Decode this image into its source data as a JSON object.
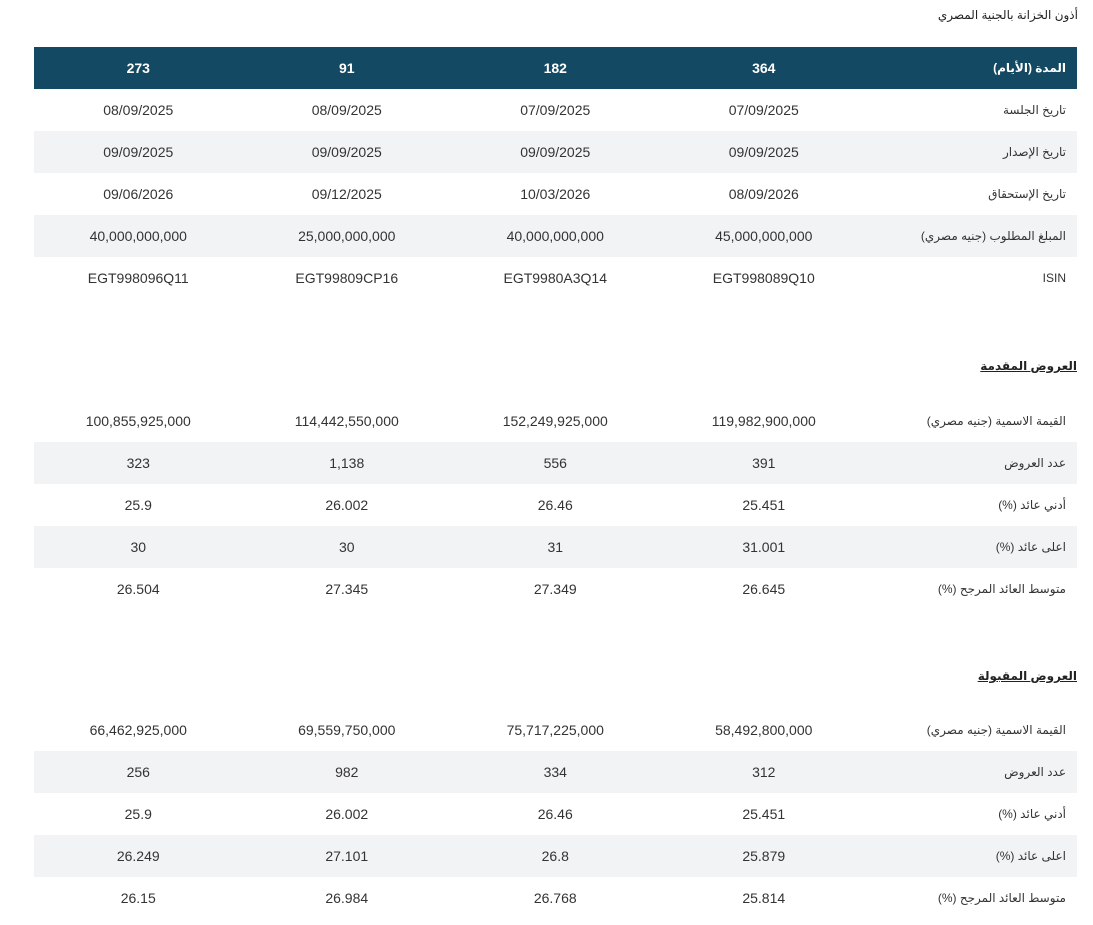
{
  "title": "أذون الخزانة بالجنية المصري",
  "main_table": {
    "header": {
      "label": "المدة (الأيام)",
      "values": [
        "364",
        "182",
        "91",
        "273"
      ]
    },
    "rows": [
      {
        "label": "تاريخ الجلسة",
        "values": [
          "07/09/2025",
          "07/09/2025",
          "08/09/2025",
          "08/09/2025"
        ]
      },
      {
        "label": "تاريخ الإصدار",
        "values": [
          "09/09/2025",
          "09/09/2025",
          "09/09/2025",
          "09/09/2025"
        ]
      },
      {
        "label": "تاريخ الإستحقاق",
        "values": [
          "08/09/2026",
          "10/03/2026",
          "09/12/2025",
          "09/06/2026"
        ]
      },
      {
        "label": "المبلغ المطلوب (جنيه مصري)",
        "values": [
          "45,000,000,000",
          "40,000,000,000",
          "25,000,000,000",
          "40,000,000,000"
        ]
      },
      {
        "label": "ISIN",
        "values": [
          "EGT998089Q10",
          "EGT9980A3Q14",
          "EGT99809CP16",
          "EGT998096Q11"
        ]
      }
    ]
  },
  "offers_submitted": {
    "title": "العروض المقدمة",
    "rows": [
      {
        "label": "القيمة الاسمية (جنيه مصري)",
        "values": [
          "119,982,900,000",
          "152,249,925,000",
          "114,442,550,000",
          "100,855,925,000"
        ]
      },
      {
        "label": "عدد العروض",
        "values": [
          "391",
          "556",
          "1,138",
          "323"
        ]
      },
      {
        "label": "أدني عائد (%)",
        "values": [
          "25.451",
          "26.46",
          "26.002",
          "25.9"
        ]
      },
      {
        "label": "اعلى عائد (%)",
        "values": [
          "31.001",
          "31",
          "30",
          "30"
        ]
      },
      {
        "label": "متوسط العائد المرجح (%)",
        "values": [
          "26.645",
          "27.349",
          "27.345",
          "26.504"
        ]
      }
    ]
  },
  "offers_accepted": {
    "title": "العروض المقبولة",
    "rows": [
      {
        "label": "القيمة الاسمية (جنيه مصري)",
        "values": [
          "58,492,800,000",
          "75,717,225,000",
          "69,559,750,000",
          "66,462,925,000"
        ]
      },
      {
        "label": "عدد العروض",
        "values": [
          "312",
          "334",
          "982",
          "256"
        ]
      },
      {
        "label": "أدني عائد (%)",
        "values": [
          "25.451",
          "26.46",
          "26.002",
          "25.9"
        ]
      },
      {
        "label": "اعلى عائد (%)",
        "values": [
          "25.879",
          "26.8",
          "27.101",
          "26.249"
        ]
      },
      {
        "label": "متوسط العائد المرجح (%)",
        "values": [
          "25.814",
          "26.768",
          "26.984",
          "26.15"
        ]
      }
    ]
  }
}
